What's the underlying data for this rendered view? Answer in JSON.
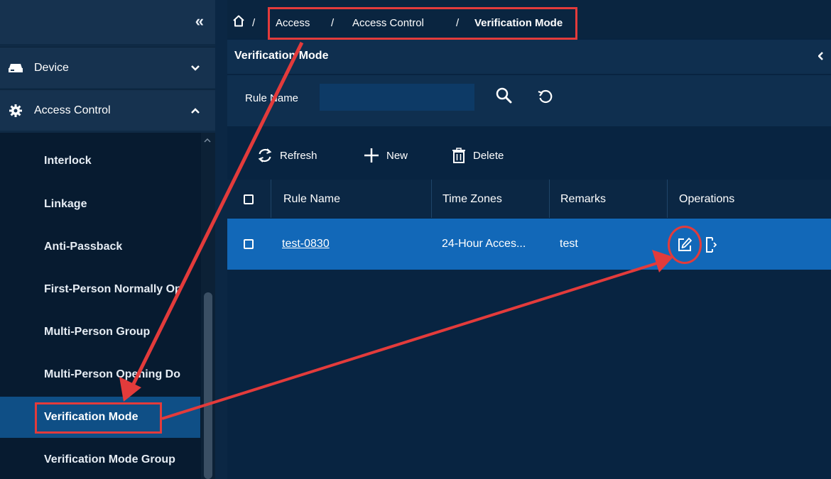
{
  "sidebar": {
    "collapse_glyph": "«",
    "device": {
      "label": "Device",
      "icon": "device-icon"
    },
    "access_control": {
      "label": "Access Control",
      "icon": "gear-icon"
    },
    "items": [
      {
        "label": "Interlock"
      },
      {
        "label": "Linkage"
      },
      {
        "label": "Anti-Passback"
      },
      {
        "label": "First-Person Normally Op"
      },
      {
        "label": "Multi-Person Group"
      },
      {
        "label": "Multi-Person Opening Do"
      },
      {
        "label": "Verification Mode"
      },
      {
        "label": "Verification Mode Group"
      }
    ]
  },
  "breadcrumb": {
    "sep": "/",
    "items": [
      "Access",
      "Access Control",
      "Verification Mode"
    ]
  },
  "panel": {
    "title": "Verification Mode",
    "filter_label": "Rule Name",
    "filter_value": ""
  },
  "toolbar": {
    "refresh": "Refresh",
    "new": "New",
    "delete": "Delete"
  },
  "table": {
    "columns": [
      "Rule Name",
      "Time Zones",
      "Remarks",
      "Operations"
    ],
    "rows": [
      {
        "rule_name": "test-0830",
        "time_zones": "24-Hour Acces...",
        "remarks": "test"
      }
    ]
  },
  "colors": {
    "annotation": "#e33b3b",
    "selected_row": "#1268b8",
    "active_menu": "#0f4f86"
  }
}
